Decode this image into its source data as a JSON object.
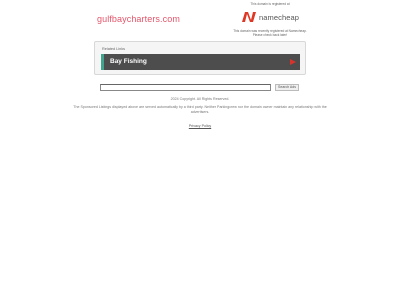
{
  "header": {
    "domain": "gulfbaycharters.com"
  },
  "registrar": {
    "registered_note": "This domain is registered at",
    "logo_text": "namecheap",
    "parked_note": "This domain was recently registered at Namecheap. Please check back later!",
    "brand_color": "#de3723"
  },
  "related": {
    "label": "Related Links",
    "links": [
      {
        "label": "Bay Fishing"
      }
    ],
    "accent_color": "#3fa58c",
    "arrow_color": "#d9342b"
  },
  "search": {
    "value": "",
    "button_label": "Search Ads"
  },
  "footer": {
    "copyright": "2024 Copyright. All Rights Reserved.",
    "disclaimer": "The Sponsored Listings displayed above are served automatically by a third party. Neither Parkingcrew nor the domain owner maintain any relationship with the advertisers.",
    "privacy_label": "Privacy Policy"
  }
}
